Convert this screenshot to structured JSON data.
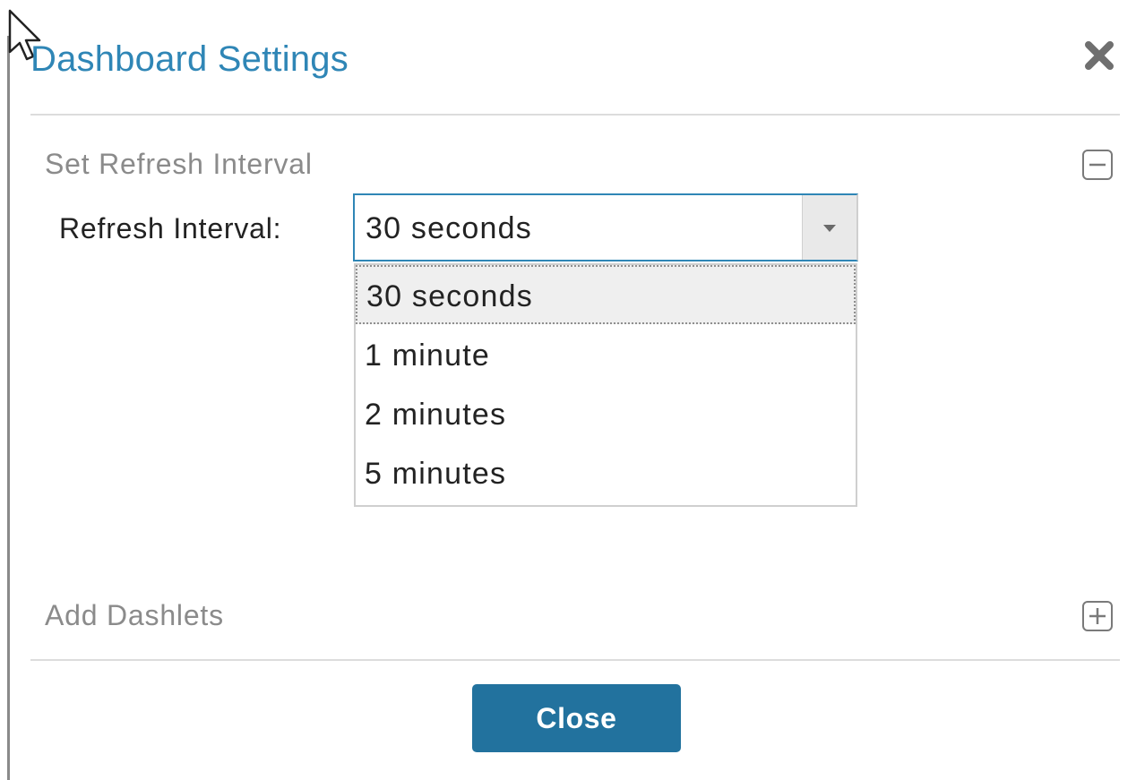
{
  "dialog": {
    "title": "Dashboard Settings",
    "close_icon": "close-x-icon"
  },
  "refresh_section": {
    "title": "Set Refresh Interval",
    "toggle_icon": "minus-box-icon",
    "field_label": "Refresh Interval:",
    "selected_value": "30 seconds",
    "options": [
      {
        "label": "30 seconds",
        "selected": true
      },
      {
        "label": "1 minute",
        "selected": false
      },
      {
        "label": "2 minutes",
        "selected": false
      },
      {
        "label": "5 minutes",
        "selected": false
      }
    ]
  },
  "dashlets_section": {
    "title": "Add Dashlets",
    "toggle_icon": "plus-box-icon"
  },
  "footer": {
    "close_label": "Close"
  },
  "colors": {
    "title_blue": "#2f86b6",
    "button_blue": "#22729e",
    "section_gray": "#8b8b8b",
    "divider": "#dcdcdc"
  }
}
